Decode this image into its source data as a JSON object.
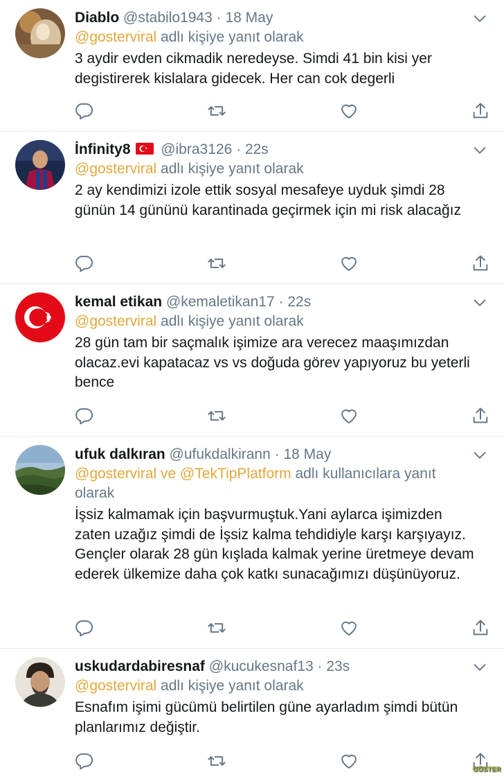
{
  "reply_prefix": "adlı kişiye yanıt olarak",
  "tweets": [
    {
      "name": "Diablo",
      "handle": "@stabilo1943",
      "dot": "·",
      "time": "18 May",
      "reply_mention": "@gosterviral",
      "reply_suffix": "adlı kişiye yanıt olarak",
      "text": "3 aydir evden cikmadik neredeyse. Simdi 41 bin kisi yer degistirerek kislalara gidecek. Her can cok degerli"
    },
    {
      "name": "İnfinity8",
      "handle": "@ibra3126",
      "dot": "·",
      "time": "22s",
      "reply_mention": "@gosterviral",
      "reply_suffix": "adlı kişiye yanıt olarak",
      "text": "2 ay kendimizi izole ettik sosyal mesafeye uyduk şimdi 28 günün 14 gününü karantinada geçirmek için mi risk alacağız"
    },
    {
      "name": "kemal etikan",
      "handle": "@kemaletikan17",
      "dot": "·",
      "time": "22s",
      "reply_mention": "@gosterviral",
      "reply_suffix": "adlı kişiye yanıt olarak",
      "text": "28 gün tam bir saçmalık işimize ara verecez maaşımızdan olacaz.evi kapatacaz vs vs doğuda görev yapıyoruz bu yeterli bence"
    },
    {
      "name": "ufuk dalkıran",
      "handle": "@ufukdalkirann",
      "dot": "·",
      "time": "18 May",
      "reply_mention": "@gosterviral ve @TekTipPlatform",
      "reply_suffix": "adlı kullanıcılara yanıt olarak",
      "text": "İşsiz kalmamak için başvurmuştuk.Yani aylarca işimizden zaten uzağız şimdi de İşsiz kalma tehdidiyle karşı karşıyayız. Gençler olarak 28 gün kışlada kalmak yerine üretmeye devam ederek ülkemize daha çok katkı sunacağımızı düşünüyoruz."
    },
    {
      "name": "uskudardabiresnaf",
      "handle": "@kucukesnaf13",
      "dot": "·",
      "time": "23s",
      "reply_mention": "@gosterviral",
      "reply_suffix": "adlı kişiye yanıt olarak",
      "text": "Esnafım işimi gücümü belirtilen güne ayarladım şimdi bütün planlarımız değiştir."
    }
  ],
  "icons": {
    "reply": "reply-icon",
    "retweet": "retweet-icon",
    "like": "heart-icon",
    "share": "share-icon",
    "caret": "chevron-down-icon"
  },
  "colors": {
    "mention": "#e1a73b",
    "secondary_text": "#657786",
    "icon": "#657786",
    "divider": "#e6ecf0"
  },
  "watermark": "GÖSTER"
}
